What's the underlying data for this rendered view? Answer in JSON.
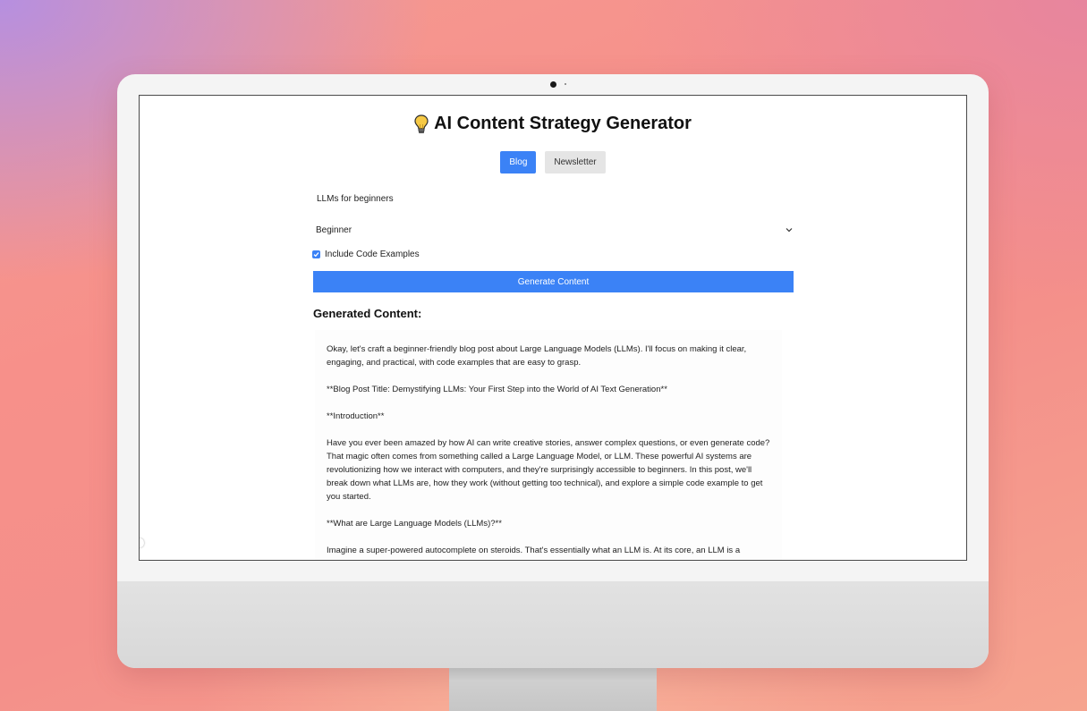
{
  "app": {
    "title": "AI Content Strategy Generator"
  },
  "tabs": [
    {
      "label": "Blog",
      "active": true
    },
    {
      "label": "Newsletter",
      "active": false
    }
  ],
  "form": {
    "topic_value": "LLMs for beginners",
    "level_value": "Beginner",
    "include_code_label": "Include Code Examples",
    "include_code_checked": true,
    "generate_label": "Generate Content"
  },
  "output": {
    "heading": "Generated Content:",
    "paragraphs": [
      "Okay, let's craft a beginner-friendly blog post about Large Language Models (LLMs). I'll focus on making it clear, engaging, and practical, with code examples that are easy to grasp.",
      "**Blog Post Title: Demystifying LLMs: Your First Step into the World of AI Text Generation**",
      "**Introduction**",
      "Have you ever been amazed by how AI can write creative stories, answer complex questions, or even generate code? That magic often comes from something called a Large Language Model, or LLM. These powerful AI systems are revolutionizing how we interact with computers, and they're surprisingly accessible to beginners. In this post, we'll break down what LLMs are, how they work (without getting too technical), and explore a simple code example to get you started.",
      "**What are Large Language Models (LLMs)?**",
      "Imagine a super-powered autocomplete on steroids. That's essentially what an LLM is. At its core, an LLM is a"
    ]
  },
  "colors": {
    "accent": "#3b82f6",
    "inactive_tab": "#e5e5e5"
  },
  "icons": {
    "title_icon": "lightbulb-icon",
    "select_icon": "chevron-down-icon",
    "checkbox_icon": "check-icon"
  }
}
